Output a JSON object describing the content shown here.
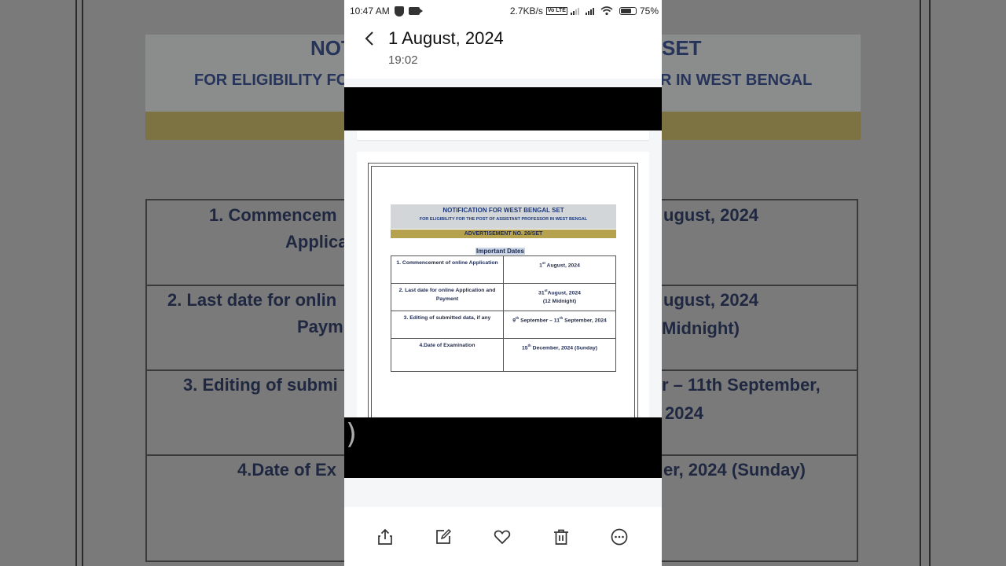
{
  "background": {
    "heading_line1_left": "NOT",
    "heading_line1_right": "SET",
    "heading_line2_left": "FOR ELIGIBILITY FO",
    "heading_line2_right": "R IN WEST BENGAL",
    "rows": [
      {
        "left": "1. Commencem",
        "left2": "Applica",
        "right": "ugust, 2024",
        "right2": ""
      },
      {
        "left": "2. Last date for onlin",
        "left2": "Paym",
        "right": "ugust, 2024",
        "right2": "Midnight)"
      },
      {
        "left": "3. Editing of submi",
        "left2": "",
        "right": "r – 11th September,",
        "right2": "2024"
      },
      {
        "left": "4.Date of Ex",
        "left2": "",
        "right": "er, 2024 (Sunday)",
        "right2": ""
      }
    ]
  },
  "status_bar": {
    "time": "10:47 AM",
    "speed": "2.7KB/s",
    "volte": "Vo LTE",
    "battery": "75%",
    "battery_level": 0.75
  },
  "header": {
    "title": "1 August, 2024",
    "time": "19:02"
  },
  "document": {
    "title": "NOTIFICATION FOR WEST BENGAL SET",
    "subtitle": "FOR ELIGIBILITY FOR THE POST OF ASSISTANT PROFESSOR IN WEST BENGAL",
    "advertisement": "ADVERTISEMENT NO. 26/SET",
    "section": "Important Dates",
    "rows": [
      {
        "label": "1. Commencement  of online Application",
        "value_a": "1",
        "sup": "st",
        "value_b": " August, 2024",
        "value_c": ""
      },
      {
        "label": "2. Last date for online Application and Payment",
        "value_a": "31",
        "sup": "st",
        "value_b": "August, 2024",
        "value_c": "(12 Midnight)"
      },
      {
        "label": "3. Editing of submitted data, if any",
        "value_a": "9",
        "sup": "th",
        "value_b": " September – 11",
        "sup2": "th",
        "value_c": " September, 2024"
      },
      {
        "label": "4.Date of Examination",
        "value_a": "15",
        "sup": "th",
        "value_b": " December, 2024 (Sunday)",
        "value_c": ""
      }
    ]
  },
  "overlay_char": ")",
  "toolbar": {
    "share": "share-icon",
    "edit": "edit-icon",
    "favorite": "heart-icon",
    "delete": "trash-icon",
    "more": "more-icon"
  }
}
